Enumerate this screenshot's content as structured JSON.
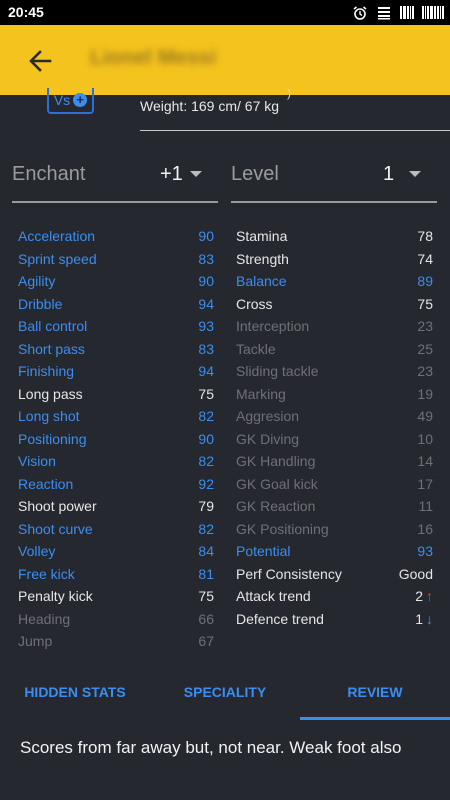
{
  "status_bar": {
    "time": "20:45",
    "icons": [
      "alarm-icon",
      "notification-list-icon",
      "barcode-icon",
      "barcode-icon"
    ]
  },
  "header": {
    "back_icon": "arrow-left-icon",
    "player_name": "Lionel Messi"
  },
  "player_info": {
    "vs_label": "Vs",
    "vs_plus": "+",
    "paren": ")",
    "weight_text": "Weight: 169 cm/ 67 kg"
  },
  "selectors": {
    "enchant": {
      "label": "Enchant",
      "value": "+1"
    },
    "level": {
      "label": "Level",
      "value": "1"
    }
  },
  "stats_left": [
    {
      "name": "Acceleration",
      "value": "90",
      "style": "highlight"
    },
    {
      "name": "Sprint speed",
      "value": "83",
      "style": "highlight"
    },
    {
      "name": "Agility",
      "value": "90",
      "style": "highlight"
    },
    {
      "name": "Dribble",
      "value": "94",
      "style": "highlight"
    },
    {
      "name": "Ball control",
      "value": "93",
      "style": "highlight"
    },
    {
      "name": "Short pass",
      "value": "83",
      "style": "highlight"
    },
    {
      "name": "Finishing",
      "value": "94",
      "style": "highlight"
    },
    {
      "name": "Long pass",
      "value": "75",
      "style": "normal"
    },
    {
      "name": "Long shot",
      "value": "82",
      "style": "highlight"
    },
    {
      "name": "Positioning",
      "value": "90",
      "style": "highlight"
    },
    {
      "name": "Vision",
      "value": "82",
      "style": "highlight"
    },
    {
      "name": "Reaction",
      "value": "92",
      "style": "highlight"
    },
    {
      "name": "Shoot power",
      "value": "79",
      "style": "normal"
    },
    {
      "name": "Shoot curve",
      "value": "82",
      "style": "highlight"
    },
    {
      "name": "Volley",
      "value": "84",
      "style": "highlight"
    },
    {
      "name": "Free kick",
      "value": "81",
      "style": "highlight"
    },
    {
      "name": "Penalty kick",
      "value": "75",
      "style": "normal"
    },
    {
      "name": "Heading",
      "value": "66",
      "style": "dim"
    },
    {
      "name": "Jump",
      "value": "67",
      "style": "dim"
    }
  ],
  "stats_right": [
    {
      "name": "Stamina",
      "value": "78",
      "style": "normal"
    },
    {
      "name": "Strength",
      "value": "74",
      "style": "normal"
    },
    {
      "name": "Balance",
      "value": "89",
      "style": "highlight"
    },
    {
      "name": "Cross",
      "value": "75",
      "style": "normal"
    },
    {
      "name": "Interception",
      "value": "23",
      "style": "dim"
    },
    {
      "name": "Tackle",
      "value": "25",
      "style": "dim"
    },
    {
      "name": "Sliding tackle",
      "value": "23",
      "style": "dim"
    },
    {
      "name": "Marking",
      "value": "19",
      "style": "dim"
    },
    {
      "name": "Aggresion",
      "value": "49",
      "style": "dim"
    },
    {
      "name": "GK Diving",
      "value": "10",
      "style": "dim"
    },
    {
      "name": "GK Handling",
      "value": "14",
      "style": "dim"
    },
    {
      "name": "GK Goal kick",
      "value": "17",
      "style": "dim"
    },
    {
      "name": "GK Reaction",
      "value": "11",
      "style": "dim"
    },
    {
      "name": "GK Positioning",
      "value": "16",
      "style": "dim"
    },
    {
      "name": "Potential",
      "value": "93",
      "style": "highlight"
    }
  ],
  "traits": [
    {
      "name": "Perf Consistency",
      "value": "Good"
    },
    {
      "name": "Attack trend",
      "value": "2",
      "arrow": "↑",
      "arrow_icon": "arrow-up-icon"
    },
    {
      "name": "Defence trend",
      "value": "1",
      "arrow": "↓",
      "arrow_icon": "arrow-down-icon"
    }
  ],
  "tabs": [
    {
      "label": "HIDDEN STATS",
      "active": false
    },
    {
      "label": "SPECIALITY",
      "active": false
    },
    {
      "label": "REVIEW",
      "active": true
    }
  ],
  "review_text": "Scores from far away but, not near. Weak foot also",
  "colors": {
    "accent_yellow": "#f5c31d",
    "highlight_blue": "#3a8ef0",
    "background": "#262830",
    "trend_up": "#d4531f"
  }
}
